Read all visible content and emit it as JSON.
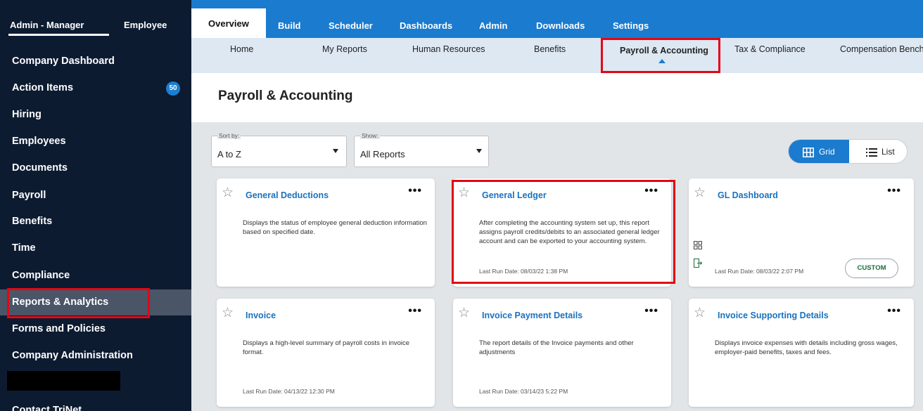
{
  "sidebar": {
    "roles": {
      "admin": "Admin - Manager",
      "employee": "Employee"
    },
    "items": [
      {
        "label": "Company Dashboard"
      },
      {
        "label": "Action Items",
        "badge": "50"
      },
      {
        "label": "Hiring"
      },
      {
        "label": "Employees"
      },
      {
        "label": "Documents"
      },
      {
        "label": "Payroll"
      },
      {
        "label": "Benefits"
      },
      {
        "label": "Time"
      },
      {
        "label": "Compliance"
      },
      {
        "label": "Reports & Analytics",
        "active": true
      },
      {
        "label": "Forms and Policies"
      },
      {
        "label": "Company Administration"
      },
      {
        "label": "Contact TriNet"
      }
    ]
  },
  "topnav": {
    "tabs": [
      "Overview",
      "Build",
      "Scheduler",
      "Dashboards",
      "Admin",
      "Downloads",
      "Settings"
    ]
  },
  "subnav": {
    "items": [
      "Home",
      "My Reports",
      "Human Resources",
      "Benefits",
      "Payroll & Accounting",
      "Tax & Compliance",
      "Compensation Benchmarking"
    ]
  },
  "page": {
    "title": "Payroll & Accounting"
  },
  "filters": {
    "sort": {
      "label": "Sort by:",
      "value": "A to Z"
    },
    "show": {
      "label": "Show:",
      "value": "All Reports"
    }
  },
  "view_toggle": {
    "grid": "Grid",
    "list": "List"
  },
  "cards": [
    {
      "title": "General Deductions",
      "desc": "Displays the status of employee general deduction information based on specified date.",
      "date": ""
    },
    {
      "title": "General Ledger",
      "desc": "After completing the accounting system set up, this report assigns payroll credits/debits to an associated general ledger account and can be exported to your accounting system.",
      "date": "Last Run Date: 08/03/22 1:38 PM"
    },
    {
      "title": "GL Dashboard",
      "desc": "",
      "date": "Last Run Date: 08/03/22 2:07 PM",
      "badge": "CUSTOM"
    },
    {
      "title": "Invoice",
      "desc": "Displays a high-level summary of payroll costs in invoice format.",
      "date": "Last Run Date: 04/13/22 12:30 PM"
    },
    {
      "title": "Invoice Payment Details",
      "desc": "The report details of the Invoice payments and other adjustments",
      "date": "Last Run Date: 03/14/23 5:22 PM"
    },
    {
      "title": "Invoice Supporting Details",
      "desc": "Displays invoice expenses with details including gross wages, employer-paid benefits, taxes and fees.",
      "date": ""
    }
  ],
  "card_menu_glyph": "•••",
  "colors": {
    "sidebar_bg": "#0d1b31",
    "accent": "#1a7bcf",
    "highlight": "#e30613",
    "link": "#1a72c0"
  }
}
